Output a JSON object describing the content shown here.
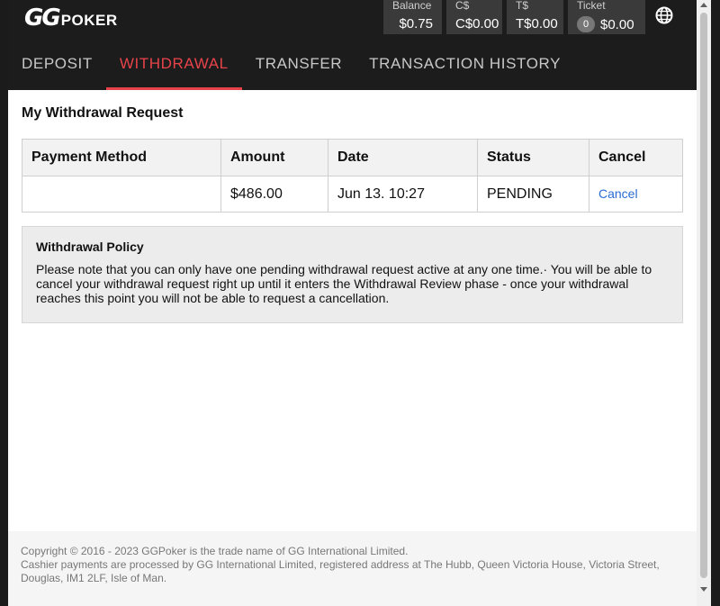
{
  "brand": {
    "gg": "GG",
    "poker": "POKER"
  },
  "balances": [
    {
      "label": "Balance",
      "value": "$0.75"
    },
    {
      "label": "C$",
      "value": "C$0.00"
    },
    {
      "label": "T$",
      "value": "T$0.00"
    },
    {
      "label": "Ticket",
      "badge": "0",
      "value": "$0.00"
    }
  ],
  "icons": {
    "globe": "globe-icon"
  },
  "tabs": [
    {
      "label": "DEPOSIT",
      "active": false
    },
    {
      "label": "WITHDRAWAL",
      "active": true
    },
    {
      "label": "TRANSFER",
      "active": false
    },
    {
      "label": "TRANSACTION HISTORY",
      "active": false
    }
  ],
  "page_title": "My Withdrawal Request",
  "table": {
    "headers": [
      "Payment Method",
      "Amount",
      "Date",
      "Status",
      "Cancel"
    ],
    "rows": [
      {
        "payment_method": "",
        "amount": "$486.00",
        "date": "Jun 13. 10:27",
        "status": "PENDING",
        "cancel": "Cancel"
      }
    ]
  },
  "policy": {
    "title": "Withdrawal Policy",
    "text": "Please note that you can only have one pending withdrawal request active at any one time.· You will be able to cancel your withdrawal request right up until it enters the Withdrawal Review phase - once your withdrawal reaches this point you will not be able to request a cancellation."
  },
  "footer": {
    "line1": "Copyright © 2016 - 2023 GGPoker is the trade name of GG International Limited.",
    "line2": "Cashier payments are processed by GG International Limited, registered address at The Hubb, Queen Victoria House, Victoria Street, Douglas, IM1 2LF, Isle of Man."
  },
  "colors": {
    "accent": "#e8434a",
    "link": "#2b6cd1",
    "header_bg": "#1c1c1c"
  }
}
